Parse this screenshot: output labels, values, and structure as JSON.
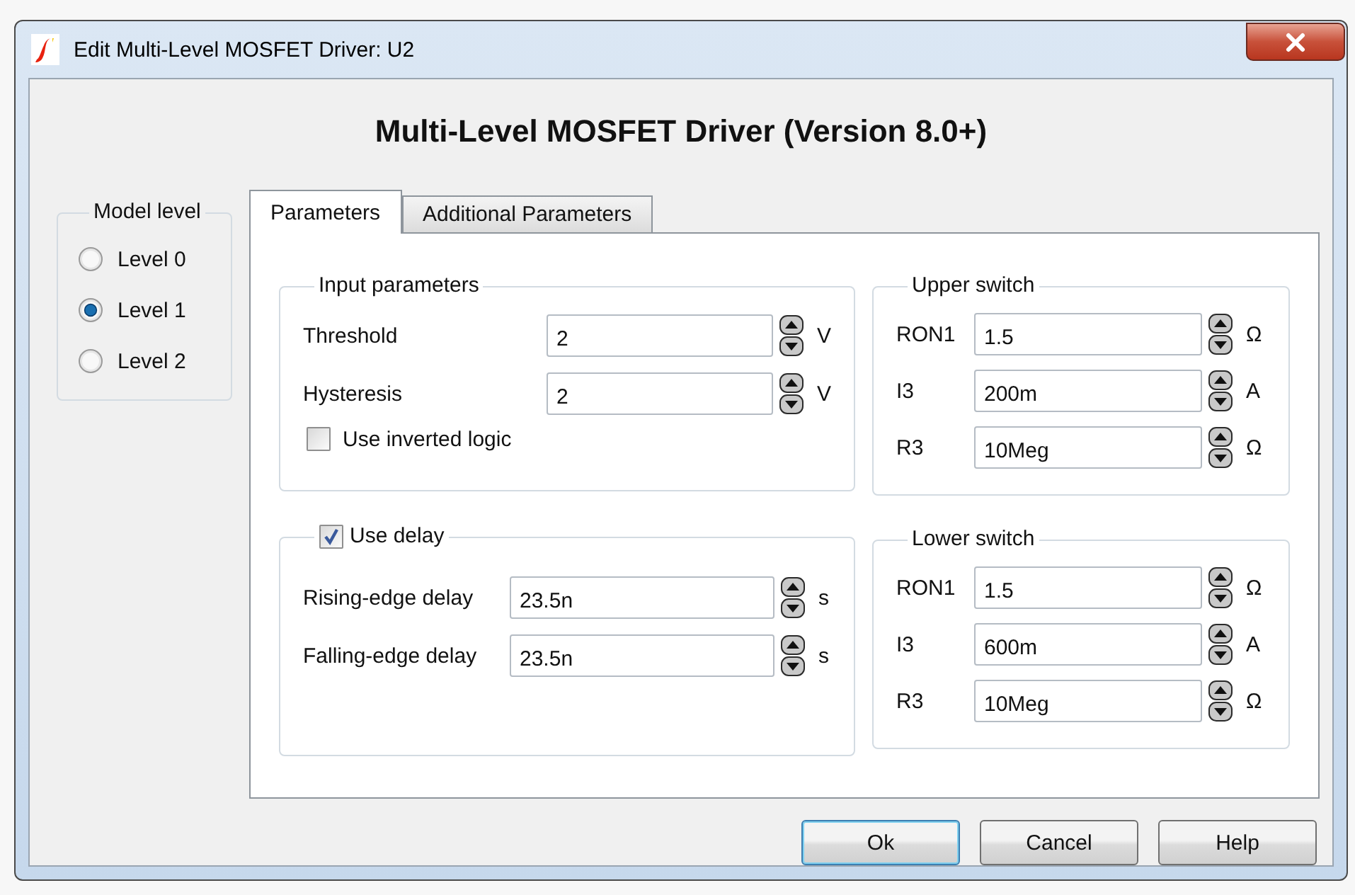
{
  "window": {
    "title": "Edit Multi-Level MOSFET Driver: U2"
  },
  "heading": "Multi-Level MOSFET Driver (Version 8.0+)",
  "model_level": {
    "title": "Model level",
    "options": [
      {
        "label": "Level 0",
        "selected": false
      },
      {
        "label": "Level 1",
        "selected": true
      },
      {
        "label": "Level 2",
        "selected": false
      }
    ]
  },
  "tabs": [
    {
      "label": "Parameters",
      "selected": true
    },
    {
      "label": "Additional Parameters",
      "selected": false
    }
  ],
  "input_parameters": {
    "title": "Input parameters",
    "fields": [
      {
        "label": "Threshold",
        "value": "2",
        "unit": "V"
      },
      {
        "label": "Hysteresis",
        "value": "2",
        "unit": "V"
      }
    ],
    "inverted_logic": {
      "label": "Use inverted logic",
      "checked": false
    }
  },
  "delay": {
    "label": "Use delay",
    "checked": true,
    "fields": [
      {
        "label": "Rising-edge delay",
        "value": "23.5n",
        "unit": "s"
      },
      {
        "label": "Falling-edge delay",
        "value": "23.5n",
        "unit": "s"
      }
    ]
  },
  "upper_switch": {
    "title": "Upper switch",
    "fields": [
      {
        "label": "RON1",
        "value": "1.5",
        "unit": "Ω"
      },
      {
        "label": "I3",
        "value": "200m",
        "unit": "A"
      },
      {
        "label": "R3",
        "value": "10Meg",
        "unit": "Ω"
      }
    ]
  },
  "lower_switch": {
    "title": "Lower switch",
    "fields": [
      {
        "label": "RON1",
        "value": "1.5",
        "unit": "Ω"
      },
      {
        "label": "I3",
        "value": "600m",
        "unit": "A"
      },
      {
        "label": "R3",
        "value": "10Meg",
        "unit": "Ω"
      }
    ]
  },
  "buttons": [
    {
      "label": "Ok",
      "focused": true
    },
    {
      "label": "Cancel",
      "focused": false
    },
    {
      "label": "Help",
      "focused": false
    }
  ]
}
